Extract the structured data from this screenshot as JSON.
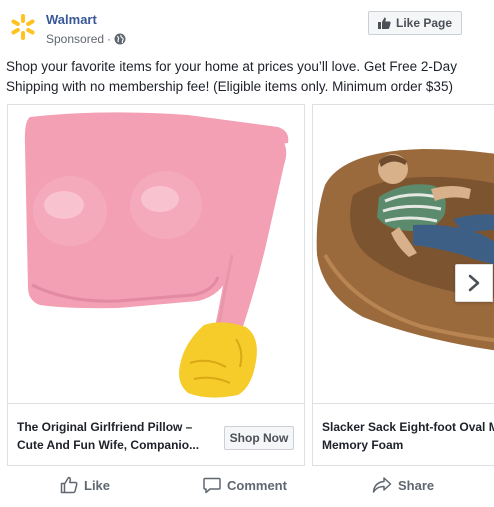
{
  "header": {
    "page_name": "Walmart",
    "sponsored": "Sponsored",
    "dot": "·",
    "like_page_label": "Like Page",
    "icons": {
      "logo": "walmart-spark-logo",
      "privacy": "globe-icon",
      "like_page": "thumbs-up-icon"
    }
  },
  "post": {
    "text": "Shop your favorite items for your home at prices you’ll love. Get Free 2-Day Shipping with no membership fee! (Eligible items only. Minimum order $35)"
  },
  "carousel": {
    "cards": [
      {
        "title": "The Original Girlfriend Pillow – Cute And Fun Wife, Companio...",
        "cta": "Shop Now"
      },
      {
        "title": "Slacker Sack Eight-foot Oval Microfiber And Memory Foam",
        "cta": ""
      }
    ],
    "next_icon": "chevron-right-icon"
  },
  "actions": {
    "like": "Like",
    "comment": "Comment",
    "share": "Share"
  },
  "colors": {
    "brand_link": "#385898",
    "walmart_yellow": "#ffc220",
    "button_bg": "#f5f6f7",
    "border": "#dddfe2",
    "muted_text": "#606770"
  }
}
